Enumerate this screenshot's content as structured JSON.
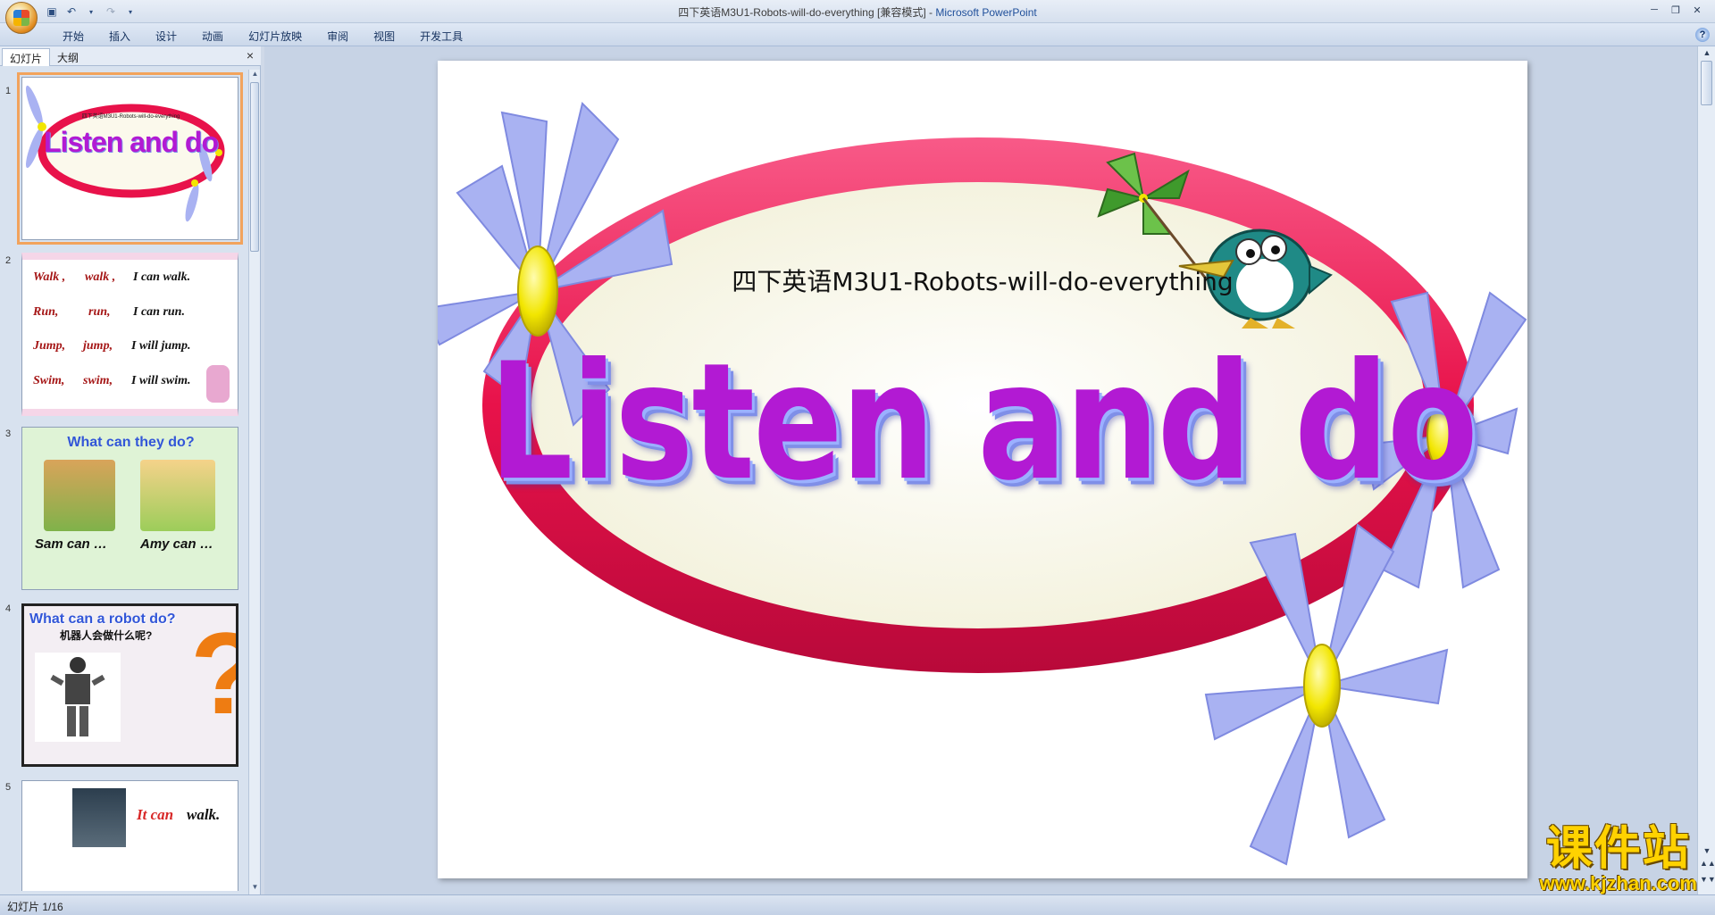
{
  "window": {
    "title": "四下英语M3U1-Robots-will-do-everything [兼容模式]",
    "title_sep": " - ",
    "app_name": "Microsoft PowerPoint"
  },
  "ribbon": {
    "tabs": [
      "开始",
      "插入",
      "设计",
      "动画",
      "幻灯片放映",
      "审阅",
      "视图",
      "开发工具"
    ]
  },
  "left_panel": {
    "tabs": [
      "幻灯片",
      "大纲"
    ],
    "close": "×"
  },
  "thumbnails": [
    {
      "num": "1",
      "subtitle": "四下英语M3U1-Robots-will-do-everything",
      "title": "Listen and do"
    },
    {
      "num": "2",
      "lines": [
        {
          "a": "Walk ,",
          "b": "walk ,",
          "c": "I  can  walk."
        },
        {
          "a": "Run,",
          "b": "run,",
          "c": "I  can run."
        },
        {
          "a": "Jump,",
          "b": "jump,",
          "c": "I will  jump."
        },
        {
          "a": "Swim,",
          "b": "swim,",
          "c": "I will  swim."
        }
      ]
    },
    {
      "num": "3",
      "heading": "What can they do?",
      "cap1": "Sam can …",
      "cap2": "Amy can …"
    },
    {
      "num": "4",
      "heading": "What can a robot do?",
      "sub": "机器人会做什么呢?"
    },
    {
      "num": "5",
      "line1_a": "It can",
      "line1_b": "walk."
    }
  ],
  "slide": {
    "subtitle": "四下英语M3U1-Robots-will-do-everything",
    "title": "Listen and do"
  },
  "status": {
    "text": "幻灯片 1/16"
  },
  "watermark": {
    "cn": "课件站",
    "url": "www.kjzhan.com"
  },
  "colors": {
    "title_purple": "#b21ad3",
    "ring_red": "#e8124a",
    "petal_lavender": "#a9b2f2",
    "flower_yellow": "#f2e600"
  }
}
